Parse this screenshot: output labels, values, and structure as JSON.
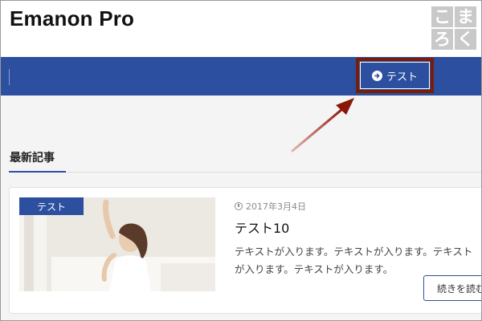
{
  "header": {
    "site_title": "Emanon Pro",
    "logo_chars": [
      "こ",
      "ま",
      "ろ",
      "く"
    ]
  },
  "nav": {
    "items": [
      {
        "label": "テスト",
        "icon": "circle-arrow-right-icon"
      }
    ]
  },
  "section": {
    "title": "最新記事"
  },
  "post": {
    "category": "テスト",
    "date": "2017年3月4日",
    "title": "テスト10",
    "excerpt": "テキストが入ります。テキストが入ります。テキストが入ります。テキストが入ります。",
    "read_more": "続きを読む"
  },
  "colors": {
    "nav_background": "#2d4fa0",
    "highlight_border": "#7a1d06",
    "logo_gray": "#c9c9c9"
  }
}
